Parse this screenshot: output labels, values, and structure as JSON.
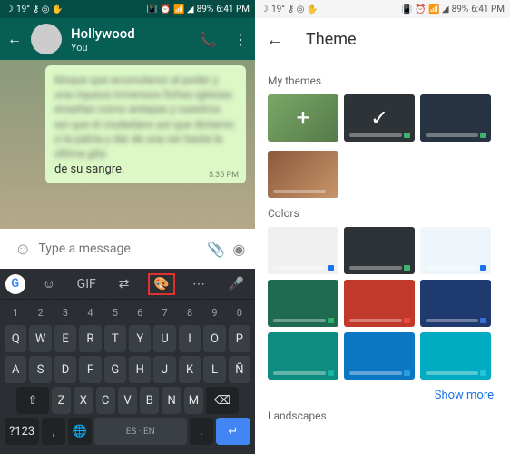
{
  "statusbar": {
    "left_icons": [
      "moon",
      "19°",
      "key",
      "circle",
      "hand"
    ],
    "right_icons": [
      "vibrate",
      "alarm",
      "wifi",
      "signal"
    ],
    "battery": "89%",
    "time": "6:41 PM"
  },
  "chat": {
    "title": "Hollywood",
    "subtitle": "You",
    "bubble_blur": "bloque que acumularon al poder y una riqueza inmensos fichas iglesias enseñan como antepas y nuestros así que el ciudadano así que dictarno o la patria y dar de una ver hasta la última gita",
    "bubble_clear": "de su sangre.",
    "bubble_time": "5:35 PM",
    "input_placeholder": "Type a message",
    "keyboard": {
      "gif": "GIF",
      "nums": [
        "1",
        "2",
        "3",
        "4",
        "5",
        "6",
        "7",
        "8",
        "9",
        "0"
      ],
      "row1": [
        "Q",
        "W",
        "E",
        "R",
        "T",
        "Y",
        "U",
        "I",
        "O",
        "P"
      ],
      "row2": [
        "A",
        "S",
        "D",
        "F",
        "G",
        "H",
        "J",
        "K",
        "L",
        "Ñ"
      ],
      "row3": [
        "Z",
        "X",
        "C",
        "V",
        "B",
        "N",
        "M"
      ],
      "sym": "?123",
      "space": "ES · EN"
    }
  },
  "theme": {
    "title": "Theme",
    "my_themes": "My themes",
    "colors": "Colors",
    "landscapes": "Landscapes",
    "show_more": "Show more",
    "mythemes": [
      {
        "type": "add"
      },
      {
        "type": "selected",
        "bg": "#2e3338",
        "dot": "#3cb371"
      },
      {
        "type": "plain",
        "bg": "#273340",
        "dot": "#3cb371"
      }
    ],
    "mythemes2": [
      {
        "type": "img"
      }
    ],
    "color_swatches": [
      {
        "bg": "#f0f0f0",
        "dot": "#1a73e8"
      },
      {
        "bg": "#2e3338",
        "dot": "#3cb371"
      },
      {
        "bg": "#eef6fb",
        "dot": "#1a73e8"
      },
      {
        "bg": "#1f6b52",
        "dot": "#2db36a"
      },
      {
        "bg": "#c0392b",
        "dot": "#e74c3c"
      },
      {
        "bg": "#1f3a6e",
        "dot": "#3a6fd8"
      },
      {
        "bg": "#0e8c7f",
        "dot": "#16b5a4"
      },
      {
        "bg": "#0b77c2",
        "dot": "#2a9fe0"
      },
      {
        "bg": "#00acc1",
        "dot": "#26c6da"
      }
    ]
  }
}
